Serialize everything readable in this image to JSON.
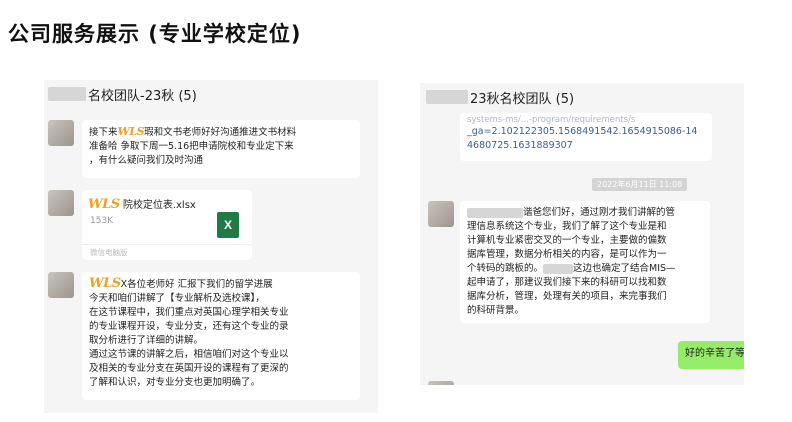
{
  "page": {
    "title": "公司服务展示 (专业学校定位)"
  },
  "left_chat": {
    "header": "名校团队-23秋 (5)",
    "msg1": {
      "line1_prefix": "接下来",
      "line1_suffix": "瑕和文书老师好好沟通推进文书材料",
      "line2": "准备哈 争取下周一5.16把申请院校和专业定下来",
      "line3": "，有什么疑问我们及时沟通"
    },
    "file": {
      "name": "院校定位表.xlsx",
      "size": "153K",
      "source": "微信电脑版",
      "icon_letter": "X"
    },
    "msg2": {
      "line1_suffix": "X各位老师好 汇报下我们的留学进展",
      "lines": [
        "今天和咱们讲解了【专业解析及选校课】，",
        "在这节课程中，我们重点对英国心理学相关专业",
        "的专业课程开设，专业分支，还有这个专业的录",
        "取分析进行了详细的讲解。",
        "通过这节课的讲解之后，相信咱们对这个专业以",
        "及相关的专业分支在英国开设的课程有了更深的",
        "了解和认识，对专业分支也更加明确了。"
      ]
    }
  },
  "right_chat": {
    "header": "23秋名校团队 (5)",
    "link_top": "systems-ms/...-program/requirements/s",
    "link_lines": [
      "_ga=2.102122305.1568491542.1654915086-14",
      "4680725.1631889307"
    ],
    "timestamp": "2022年6月11日 11:08",
    "msg": {
      "line1": "谐爸您们好，通过刚才我们讲解的管",
      "lines": [
        "理信息系统这个专业，我们了解了这个专业是和",
        "计算机专业紧密交叉的一个专业，主要做的偏数",
        "据库管理，数据分析相关的内容，是可以作为一",
        "个转码的跳板的。",
        "起申请了，那建议我们接下来的科研可以找和数",
        "据库分析，管理，处理有关的项目，来完事我们",
        "的科研背景。"
      ],
      "line5_suffix": "这边也确定了结合MIS—"
    },
    "reply": "好的辛苦了等"
  },
  "brand": {
    "logo_text": "WLS"
  },
  "colors": {
    "wls_orange": "#f2a11c",
    "wechat_green": "#95ec69",
    "excel_green": "#1f7a45",
    "link_blue": "#3b5e8c"
  }
}
